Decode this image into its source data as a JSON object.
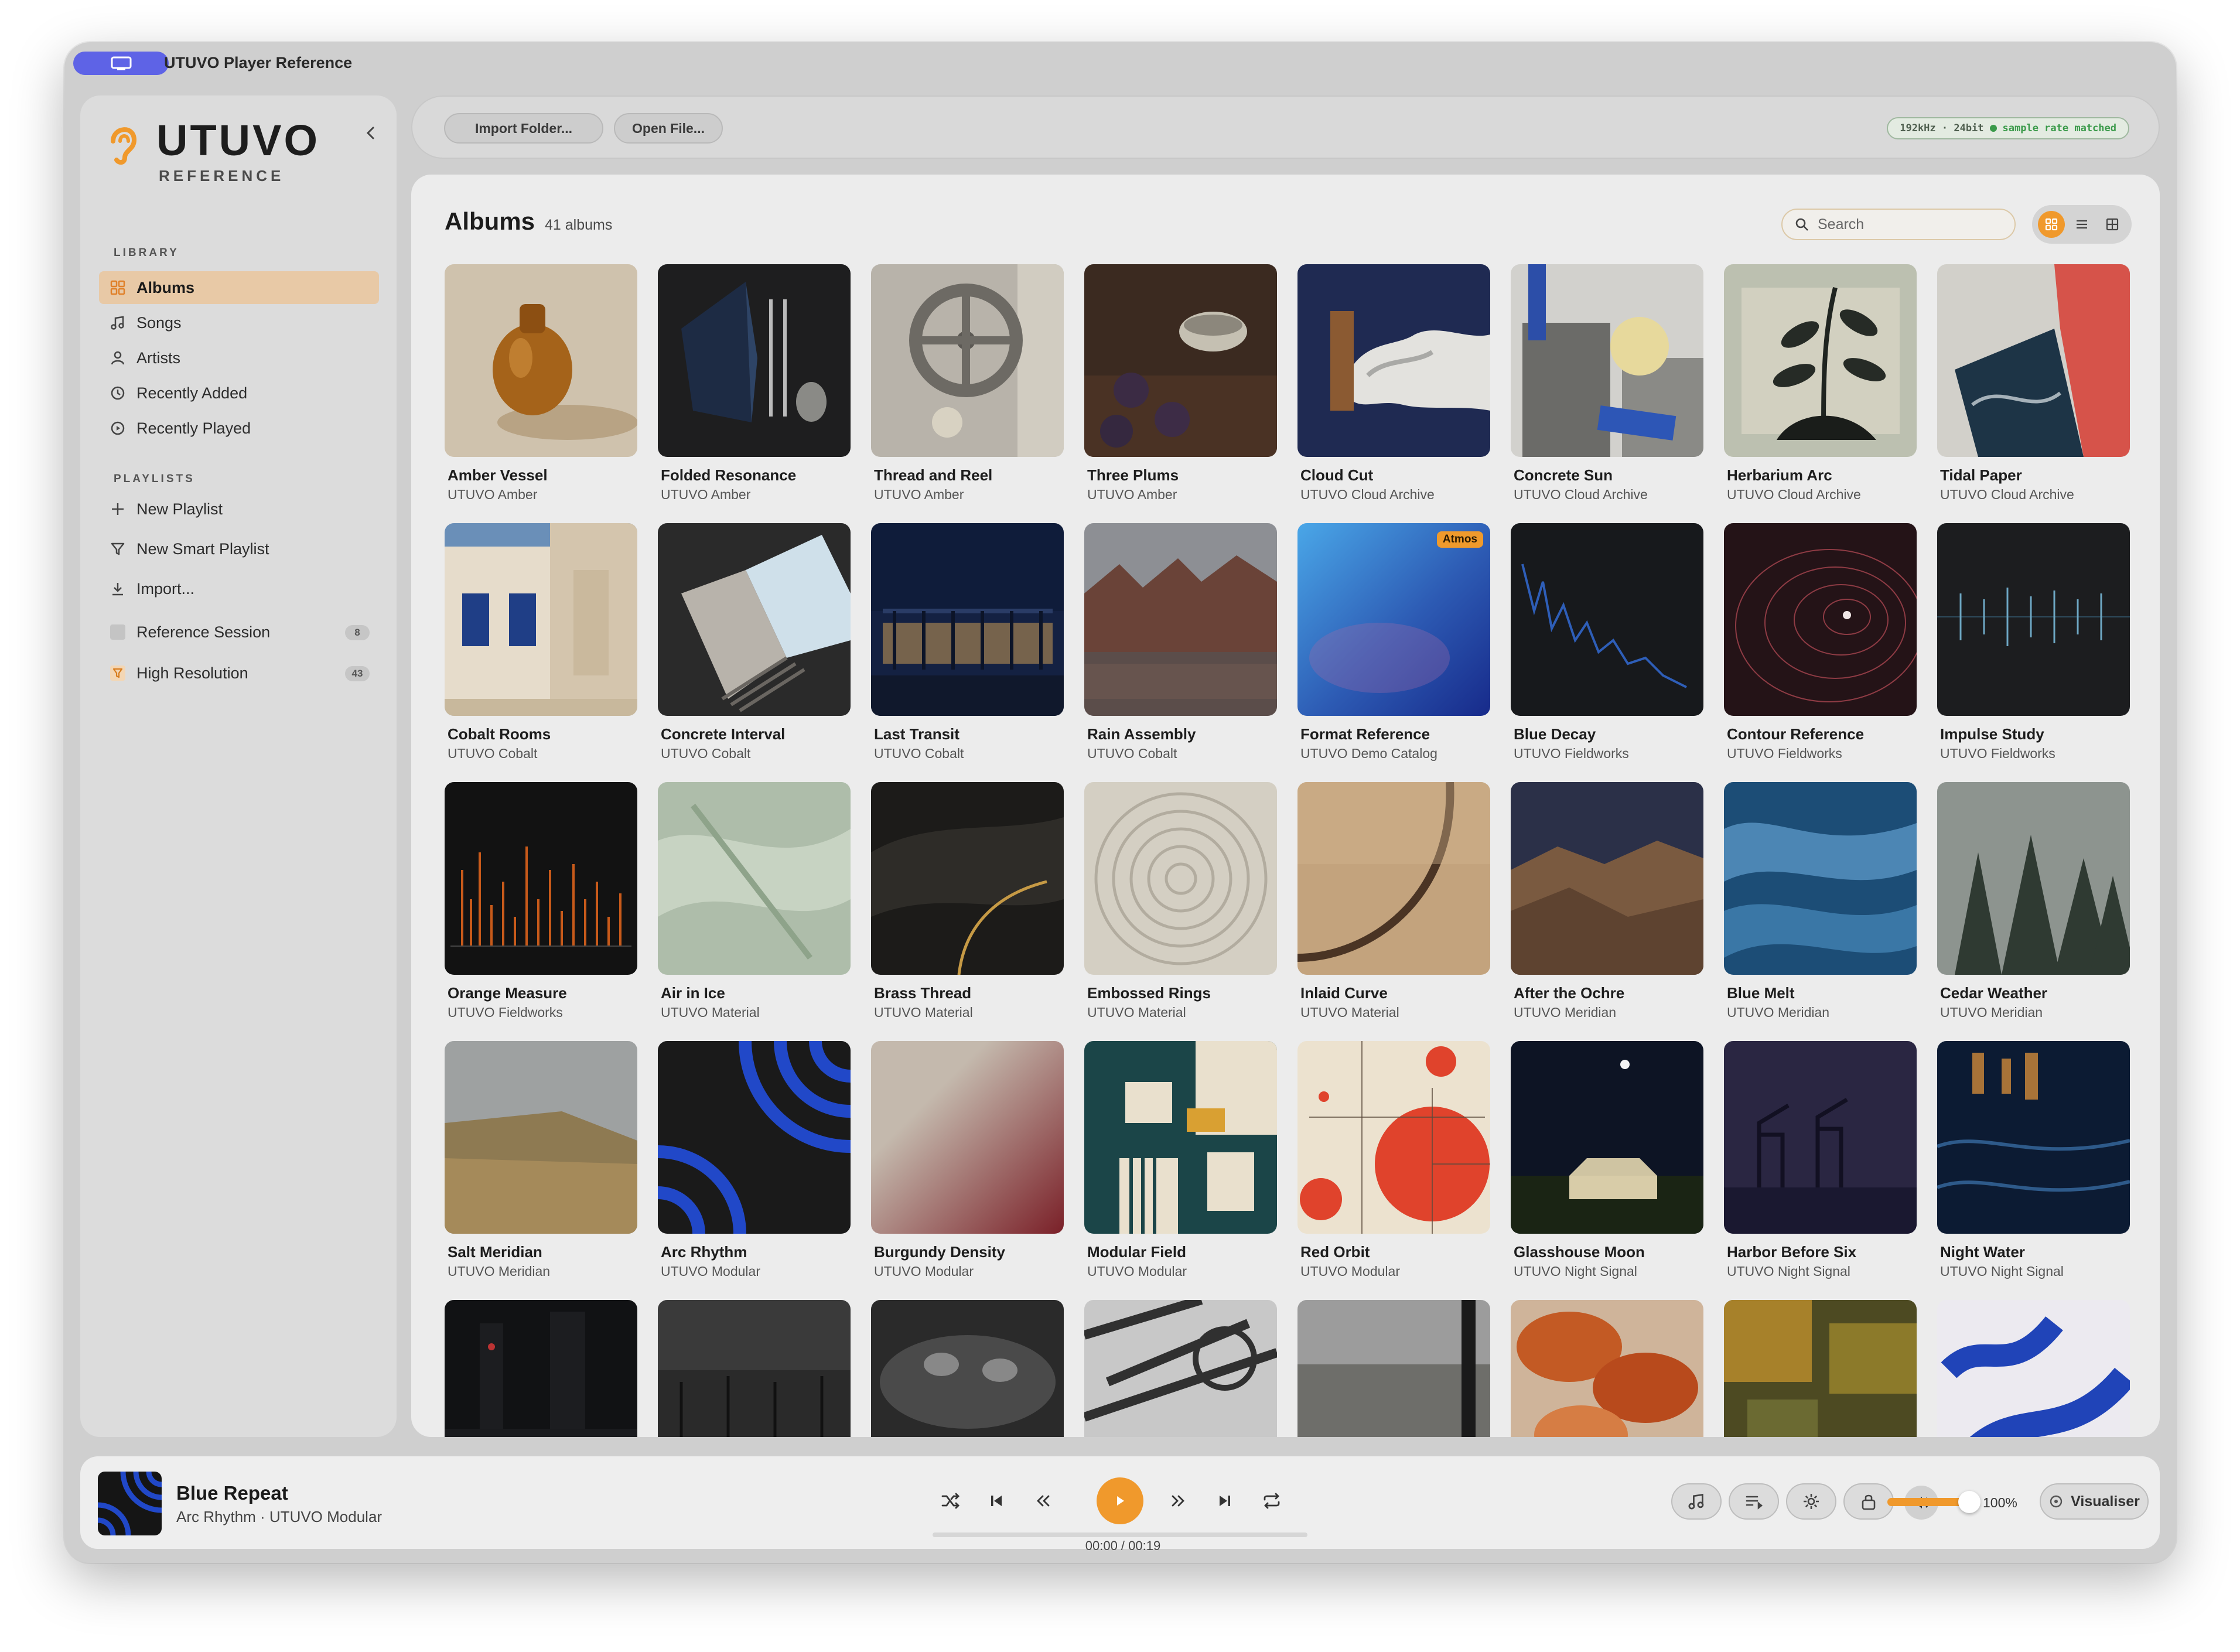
{
  "window": {
    "title": "UTUVO Player Reference"
  },
  "sidebar": {
    "logo": "UTUVO",
    "logo_sub": "REFERENCE",
    "library_label": "LIBRARY",
    "library": [
      {
        "label": "Albums",
        "icon": "grid-icon",
        "active": true
      },
      {
        "label": "Songs",
        "icon": "music-note-icon"
      },
      {
        "label": "Artists",
        "icon": "person-icon"
      },
      {
        "label": "Recently Added",
        "icon": "clock-icon"
      },
      {
        "label": "Recently Played",
        "icon": "play-circle-icon"
      }
    ],
    "playlists_label": "PLAYLISTS",
    "playlist_actions": [
      {
        "label": "New Playlist",
        "icon": "plus-icon"
      },
      {
        "label": "New Smart Playlist",
        "icon": "filter-icon"
      },
      {
        "label": "Import...",
        "icon": "download-icon"
      }
    ],
    "playlists": [
      {
        "label": "Reference Session",
        "count": "8",
        "icon": "playlist-square-icon"
      },
      {
        "label": "High Resolution",
        "count": "43",
        "icon": "smart-filter-icon"
      }
    ]
  },
  "toolbar": {
    "import_folder": "Import Folder...",
    "open_file": "Open File...",
    "sample_rate": "192kHz · 24bit",
    "sample_rate_status": "sample rate matched"
  },
  "main": {
    "title": "Albums",
    "count": "41 albums",
    "search_placeholder": "Search",
    "albums": [
      {
        "name": "Amber Vessel",
        "artist": "UTUVO Amber"
      },
      {
        "name": "Folded Resonance",
        "artist": "UTUVO Amber"
      },
      {
        "name": "Thread and Reel",
        "artist": "UTUVO Amber"
      },
      {
        "name": "Three Plums",
        "artist": "UTUVO Amber"
      },
      {
        "name": "Cloud Cut",
        "artist": "UTUVO Cloud Archive"
      },
      {
        "name": "Concrete Sun",
        "artist": "UTUVO Cloud Archive"
      },
      {
        "name": "Herbarium Arc",
        "artist": "UTUVO Cloud Archive"
      },
      {
        "name": "Tidal Paper",
        "artist": "UTUVO Cloud Archive"
      },
      {
        "name": "Cobalt Rooms",
        "artist": "UTUVO Cobalt"
      },
      {
        "name": "Concrete Interval",
        "artist": "UTUVO Cobalt"
      },
      {
        "name": "Last Transit",
        "artist": "UTUVO Cobalt"
      },
      {
        "name": "Rain Assembly",
        "artist": "UTUVO Cobalt"
      },
      {
        "name": "Format Reference",
        "artist": "UTUVO Demo Catalog",
        "badge": "Atmos"
      },
      {
        "name": "Blue Decay",
        "artist": "UTUVO Fieldworks"
      },
      {
        "name": "Contour Reference",
        "artist": "UTUVO Fieldworks"
      },
      {
        "name": "Impulse Study",
        "artist": "UTUVO Fieldworks"
      },
      {
        "name": "Orange Measure",
        "artist": "UTUVO Fieldworks"
      },
      {
        "name": "Air in Ice",
        "artist": "UTUVO Material"
      },
      {
        "name": "Brass Thread",
        "artist": "UTUVO Material"
      },
      {
        "name": "Embossed Rings",
        "artist": "UTUVO Material"
      },
      {
        "name": "Inlaid Curve",
        "artist": "UTUVO Material"
      },
      {
        "name": "After the Ochre",
        "artist": "UTUVO Meridian"
      },
      {
        "name": "Blue Melt",
        "artist": "UTUVO Meridian"
      },
      {
        "name": "Cedar Weather",
        "artist": "UTUVO Meridian"
      },
      {
        "name": "Salt Meridian",
        "artist": "UTUVO Meridian"
      },
      {
        "name": "Arc Rhythm",
        "artist": "UTUVO Modular"
      },
      {
        "name": "Burgundy Density",
        "artist": "UTUVO Modular"
      },
      {
        "name": "Modular Field",
        "artist": "UTUVO Modular"
      },
      {
        "name": "Red Orbit",
        "artist": "UTUVO Modular"
      },
      {
        "name": "Glasshouse Moon",
        "artist": "UTUVO Night Signal"
      },
      {
        "name": "Harbor Before Six",
        "artist": "UTUVO Night Signal"
      },
      {
        "name": "Night Water",
        "artist": "UTUVO Night Signal"
      },
      {
        "name": "",
        "artist": ""
      },
      {
        "name": "",
        "artist": ""
      },
      {
        "name": "",
        "artist": ""
      },
      {
        "name": "",
        "artist": ""
      },
      {
        "name": "",
        "artist": ""
      },
      {
        "name": "",
        "artist": ""
      },
      {
        "name": "",
        "artist": ""
      },
      {
        "name": "",
        "artist": ""
      }
    ]
  },
  "player": {
    "title": "Blue Repeat",
    "subtitle": "Arc Rhythm · UTUVO Modular",
    "time": "00:00 / 00:19",
    "progress": 0,
    "volume_percent": 100,
    "volume_label": "100%",
    "visualiser": "Visualiser"
  },
  "colors": {
    "accent": "#f0992c",
    "title_pill": "#5e63e6"
  }
}
